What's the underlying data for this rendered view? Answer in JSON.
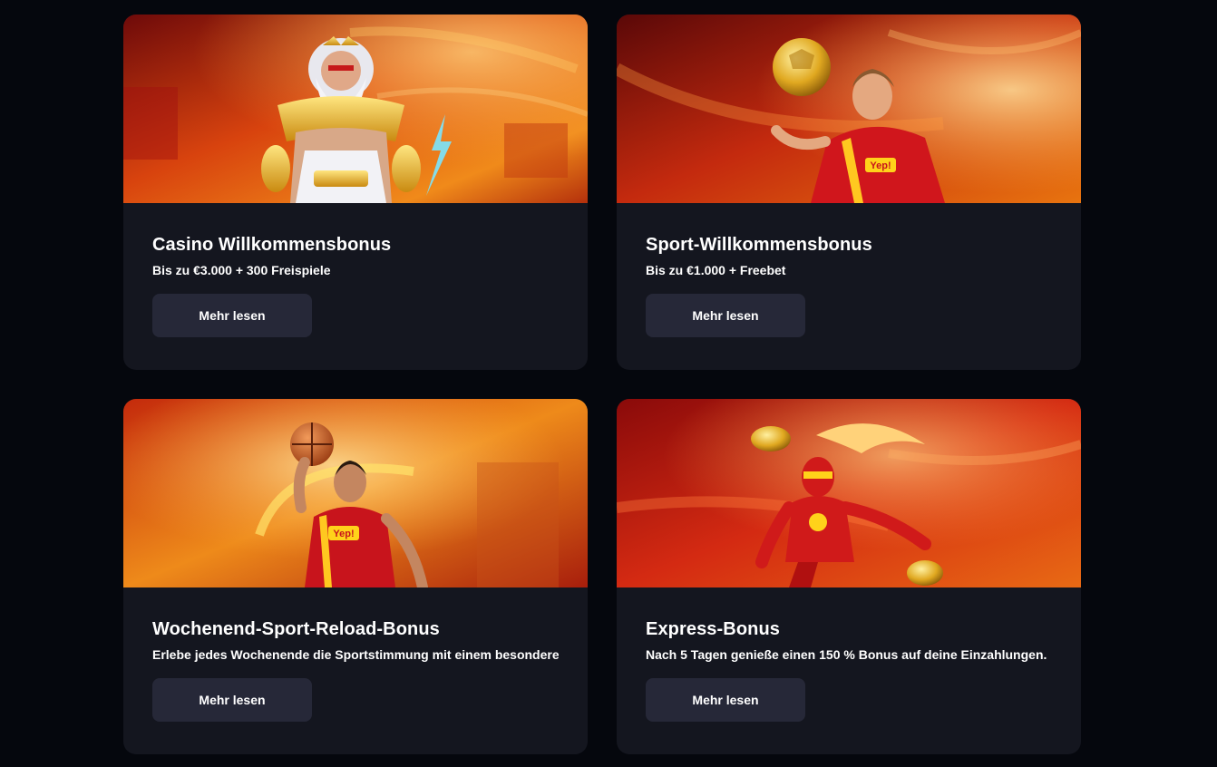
{
  "cards": [
    {
      "title": "Casino Willkommensbonus",
      "subtitle": "Bis zu €3.000 + 300 Freispiele",
      "button_label": "Mehr lesen",
      "image": "casino-god-illustration"
    },
    {
      "title": "Sport-Willkommensbonus",
      "subtitle": "Bis zu €1.000 + Freebet",
      "button_label": "Mehr lesen",
      "image": "football-player-illustration",
      "jersey_text": "Yep!"
    },
    {
      "title": "Wochenend-Sport-Reload-Bonus",
      "subtitle": "Erlebe jedes Wochenende die Sportstimmung mit einem besonderen",
      "button_label": "Mehr lesen",
      "image": "basketball-player-illustration",
      "jersey_text": "Yep!"
    },
    {
      "title": "Express-Bonus",
      "subtitle": "Nach 5 Tagen genieße einen 150 % Bonus auf deine Einzahlungen.",
      "button_label": "Mehr lesen",
      "image": "speed-heroine-illustration"
    }
  ],
  "colors": {
    "page_background": "#05070d",
    "card_background": "#14161f",
    "button_background": "#262838",
    "brand_red": "#c8141c",
    "brand_orange": "#f07a12",
    "brand_yellow": "#ffd21a"
  }
}
